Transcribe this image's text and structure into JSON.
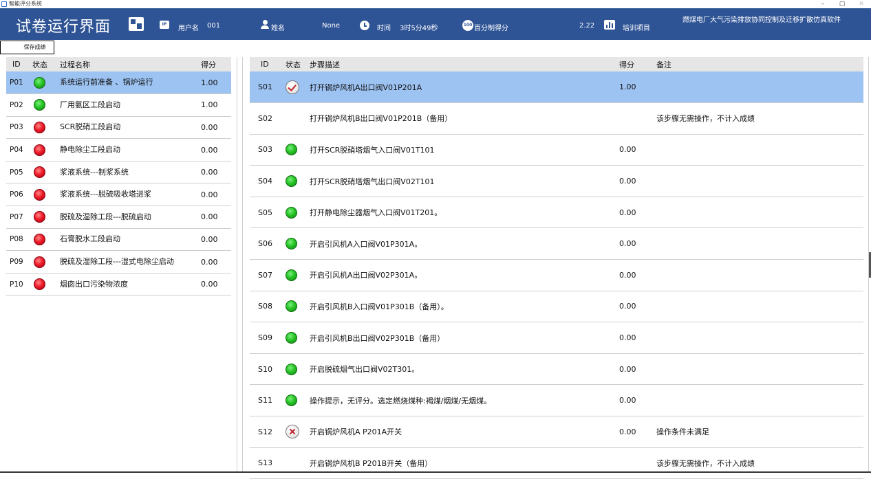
{
  "window": {
    "title": "智能评分系统",
    "controls": [
      "–",
      "▢",
      "✕"
    ]
  },
  "header": {
    "title": "试卷运行界面",
    "username_label": "用户名",
    "username_value": "001",
    "name_label": "姓名",
    "name_value": "None",
    "time_label": "时间",
    "time_value": "3时5分49秒",
    "score_label": "百分制得分",
    "score_value": "2.22",
    "project_label": "培训项目",
    "project_value": "燃煤电厂大气污染排放协同控制及迁移扩散仿真软件",
    "ip_icon_text": "IP",
    "hundred_icon_text": "100"
  },
  "toolbar": {
    "save_label": "保存成绩"
  },
  "left_table": {
    "headers": {
      "id": "ID",
      "status": "状态",
      "name": "过程名称",
      "score": "得分"
    },
    "rows": [
      {
        "id": "P01",
        "status": "green",
        "name": "系统运行前准备 、锅炉运行",
        "score": "1.00",
        "selected": true
      },
      {
        "id": "P02",
        "status": "green",
        "name": " 厂用氨区工段启动",
        "score": "1.00"
      },
      {
        "id": "P03",
        "status": "red",
        "name": "SCR脱硝工段启动",
        "score": "0.00"
      },
      {
        "id": "P04",
        "status": "red",
        "name": "静电除尘工段启动",
        "score": "0.00"
      },
      {
        "id": "P05",
        "status": "red",
        "name": "浆液系统---制浆系统",
        "score": "0.00"
      },
      {
        "id": "P06",
        "status": "red",
        "name": "浆液系统---脱硫吸收塔进浆",
        "score": "0.00"
      },
      {
        "id": "P07",
        "status": "red",
        "name": "脱硫及湿除工段---脱硫启动",
        "score": "0.00"
      },
      {
        "id": "P08",
        "status": "red",
        "name": "石膏脱水工段启动",
        "score": "0.00"
      },
      {
        "id": "P09",
        "status": "red",
        "name": "脱硫及湿除工段---湿式电除尘启动",
        "score": "0.00"
      },
      {
        "id": "P10",
        "status": "red",
        "name": "烟囱出口污染物浓度",
        "score": "0.00"
      }
    ]
  },
  "right_table": {
    "headers": {
      "id": "ID",
      "status": "状态",
      "desc": "步骤描述",
      "score": "得分",
      "note": "备注"
    },
    "rows": [
      {
        "id": "S01",
        "status": "check",
        "desc": "打开锅炉风机A出口阀V01P201A",
        "score": "1.00",
        "note": "",
        "selected": true
      },
      {
        "id": "S02",
        "status": "none",
        "desc": "打开锅炉风机B出口阀V01P201B（备用）",
        "score": "",
        "note": "该步骤无需操作，不计入成绩"
      },
      {
        "id": "S03",
        "status": "green",
        "desc": "打开SCR脱硝塔烟气入口阀V01T101",
        "score": "0.00",
        "note": ""
      },
      {
        "id": "S04",
        "status": "green",
        "desc": "打开SCR脱硝塔烟气出口阀V02T101",
        "score": "0.00",
        "note": ""
      },
      {
        "id": "S05",
        "status": "green",
        "desc": "打开静电除尘器烟气入口阀V01T201。",
        "score": "0.00",
        "note": ""
      },
      {
        "id": "S06",
        "status": "green",
        "desc": "开启引风机A入口阀V01P301A。",
        "score": "0.00",
        "note": ""
      },
      {
        "id": "S07",
        "status": "green",
        "desc": "开启引风机A出口阀V02P301A。",
        "score": "0.00",
        "note": ""
      },
      {
        "id": "S08",
        "status": "green",
        "desc": "开启引风机B入口阀V01P301B（备用）。",
        "score": "0.00",
        "note": ""
      },
      {
        "id": "S09",
        "status": "green",
        "desc": "开启引风机B出口阀V02P301B（备用）",
        "score": "0.00",
        "note": ""
      },
      {
        "id": "S10",
        "status": "green",
        "desc": "开启脱硫烟气出口阀V02T301。",
        "score": "0.00",
        "note": ""
      },
      {
        "id": "S11",
        "status": "green",
        "desc": "操作提示，无评分。选定燃烧煤种:褐煤/烟煤/无烟煤。",
        "score": "0.00",
        "note": ""
      },
      {
        "id": "S12",
        "status": "cross",
        "desc": "开启锅炉风机A P201A开关",
        "score": "0.00",
        "note": "操作条件未满足"
      },
      {
        "id": "S13",
        "status": "none",
        "desc": "开启锅炉风机B P201B开关（备用）",
        "score": "",
        "note": "该步骤无需操作，不计入成绩"
      }
    ]
  },
  "colors": {
    "header_bg": "#2f5496",
    "selected_row": "#9dc3f2",
    "status_green": "#27c427",
    "status_red": "#ee1c2a"
  }
}
